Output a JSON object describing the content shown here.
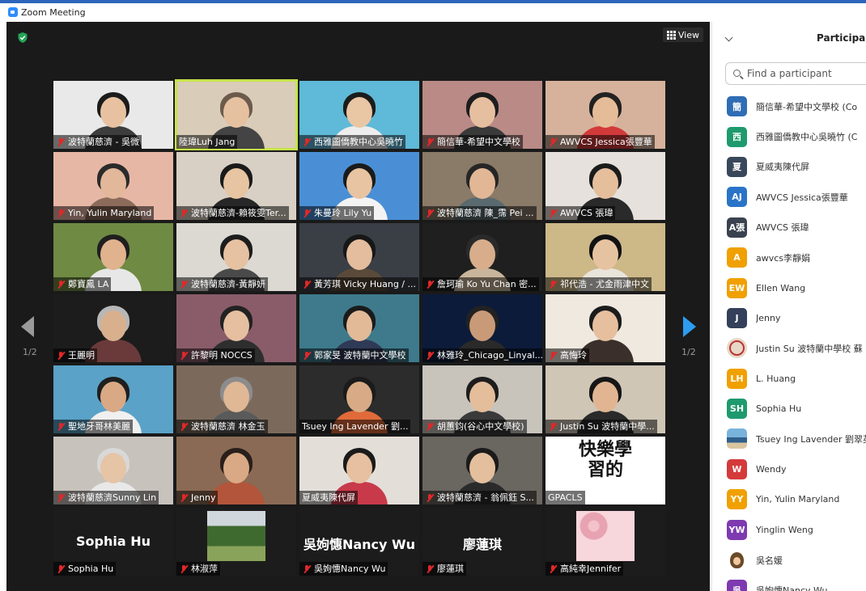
{
  "window": {
    "title": "Zoom Meeting"
  },
  "toolbar": {
    "view_label": "View"
  },
  "pagination": {
    "left": "1/2",
    "right": "1/2"
  },
  "tiles": [
    {
      "name": "波特蘭慈濟 - 吳微",
      "muted": true,
      "bg": "#e9e9e9",
      "skin": "#e8c2a0",
      "hair": "#1c1c1c",
      "shirt": "#3d3d3d"
    },
    {
      "name": "陸瑋Luh Jang",
      "muted": false,
      "active": true,
      "bg": "#d9ccb8",
      "skin": "#e6c1a0",
      "hair": "#6c5b4c",
      "shirt": "#444444"
    },
    {
      "name": "西雅圖僑教中心吳曉竹",
      "muted": true,
      "bg": "#5fb9d8",
      "skin": "#e9c6a4",
      "hair": "#1c1c1c",
      "shirt": "#ededed"
    },
    {
      "name": "簡信華-希望中文學校",
      "muted": true,
      "bg": "#b98a86",
      "skin": "#e6bfa0",
      "hair": "#1d1d1d",
      "shirt": "#3a3a3a"
    },
    {
      "name": "AWVCS Jessica張豐華",
      "muted": true,
      "bg": "#d6b29c",
      "skin": "#e5bc98",
      "hair": "#222222",
      "shirt": "#d23a3a"
    },
    {
      "name": "Yin, Yulin  Maryland",
      "muted": true,
      "bg": "#e7b7a6",
      "skin": "#e2b79a",
      "hair": "#2b2b2b",
      "shirt": "#8c6b5a"
    },
    {
      "name": "波特蘭慈濟-賴筱雯Ter...",
      "muted": true,
      "bg": "#d8d0c4",
      "skin": "#e7c4a2",
      "hair": "#1a1a1a",
      "shirt": "#272727"
    },
    {
      "name": "朱曼玲 Lily Yu",
      "muted": true,
      "bg": "#4a8fd6",
      "skin": "#e8c4a2",
      "hair": "#1b1b1b",
      "shirt": "#f3f3f3"
    },
    {
      "name": "波特蘭慈濟 陳_霈 Pei ...",
      "muted": true,
      "bg": "#8a7a68",
      "skin": "#e2b795",
      "hair": "#262626",
      "shirt": "#5a6a6f"
    },
    {
      "name": "AWVCS 張瑋",
      "muted": true,
      "bg": "#e6e1dc",
      "skin": "#e5be9c",
      "hair": "#1b1b1b",
      "shirt": "#2a2a2a"
    },
    {
      "name": "鄭寶鳳 LA",
      "muted": true,
      "bg": "#6f8a43",
      "skin": "#e0b28e",
      "hair": "#1f1f1f",
      "shirt": "#e7e7e7"
    },
    {
      "name": "波特蘭慈濟-黃靜妍",
      "muted": true,
      "bg": "#dcd8d2",
      "skin": "#e6c2a2",
      "hair": "#1d1d1d",
      "shirt": "#4a4a4a"
    },
    {
      "name": "黃芳琪 Vicky Huang / ...",
      "muted": true,
      "bg": "#3a3f46",
      "skin": "#e3bd9d",
      "hair": "#171717",
      "shirt": "#5a4a3a"
    },
    {
      "name": "詹珂瑜 Ko Yu Chan 密...",
      "muted": true,
      "bg": "#1f1f1f",
      "skin": "#d7ad8b",
      "hair": "#2a2a2a",
      "shirt": "#c9b59c"
    },
    {
      "name": "祁代浩 - 尤金雨津中文",
      "muted": true,
      "bg": "#cdb888",
      "skin": "#e6c3a0",
      "hair": "#121212",
      "shirt": "#e9e4dc"
    },
    {
      "name": "王麗明",
      "muted": true,
      "bg": "#1c1c1c",
      "skin": "#d9b08e",
      "hair": "#b7b7b7",
      "shirt": "#6a3a3a"
    },
    {
      "name": "許黎明 NOCCS",
      "muted": true,
      "bg": "#8a5c6a",
      "skin": "#e5bfa0",
      "hair": "#222222",
      "shirt": "#2e2e2e"
    },
    {
      "name": "郭家旻 波特蘭中文學校",
      "muted": true,
      "bg": "#3e7a8c",
      "skin": "#e2ba98",
      "hair": "#1b1b1b",
      "shirt": "#2f3a56"
    },
    {
      "name": "林雅玲_Chicago_Linyal...",
      "muted": true,
      "bg": "#0c1b3a",
      "skin": "#c99a78",
      "hair": "#222222",
      "shirt": "#2a2a2a"
    },
    {
      "name": "高悔玲",
      "muted": true,
      "bg": "#efe9e0",
      "skin": "#e6bf9e",
      "hair": "#1c1c1c",
      "shirt": "#3a2f2a"
    },
    {
      "name": "聖地牙哥林美麗",
      "muted": true,
      "bg": "#5aa2c8",
      "skin": "#d9a985",
      "hair": "#1f1f1f",
      "shirt": "#f0f0f0"
    },
    {
      "name": "波特蘭慈濟 林金玉",
      "muted": true,
      "bg": "#7b6a5c",
      "skin": "#e0b896",
      "hair": "#8c8c8c",
      "shirt": "#5a5a5a"
    },
    {
      "name": "Tsuey Ing Lavender 劉...",
      "muted": false,
      "bg": "#2c2c2c",
      "skin": "#d8ab86",
      "hair": "#1b1b1b",
      "shirt": "#e06a3a"
    },
    {
      "name": "胡蕙鈞(谷心中文學校)",
      "muted": true,
      "bg": "#c8c4bc",
      "skin": "#e4bd9b",
      "hair": "#1d1d1d",
      "shirt": "#3a3a3a"
    },
    {
      "name": "Justin Su 波特蘭中學...",
      "muted": true,
      "bg": "#cfc6b6",
      "skin": "#e1b592",
      "hair": "#161616",
      "shirt": "#2a2a2a"
    },
    {
      "name": "波特蘭慈濟Sunny Lin",
      "muted": true,
      "bg": "#c7c2bc",
      "skin": "#e6c4a6",
      "hair": "#d8d8d8",
      "shirt": "#e8e8e8"
    },
    {
      "name": "Jenny",
      "muted": true,
      "bg": "#8a6a54",
      "skin": "#d9a985",
      "hair": "#2a1f1a",
      "shirt": "#b2553a"
    },
    {
      "name": "夏威夷陳代屏",
      "muted": false,
      "bg": "#e3ded8",
      "skin": "#e6c0a0",
      "hair": "#1a1a1a",
      "shirt": "#c83a4a"
    },
    {
      "name": "波特蘭慈濟 - 翁佩鈺 S...",
      "muted": true,
      "bg": "#6a6660",
      "skin": "#e4bf9e",
      "hair": "#1b1b1b",
      "shirt": "#2a2a2a"
    },
    {
      "name": "GPACLS",
      "muted": false,
      "bg": "#ffffff",
      "calligraphy": "快樂學習的",
      "skin": "",
      "hair": "",
      "shirt": ""
    },
    {
      "name": "Sophia Hu",
      "muted": true,
      "bg": "#1c1c1c",
      "big": "Sophia Hu"
    },
    {
      "name": "林淑萍",
      "muted": true,
      "bg": "#1c1c1c",
      "photo": "garden"
    },
    {
      "name": "吳姁憓Nancy Wu",
      "muted": true,
      "bg": "#1c1c1c",
      "big": "吳姁憓Nancy  Wu"
    },
    {
      "name": "廖蓮琪",
      "muted": true,
      "bg": "#1c1c1c",
      "big": "廖蓮琪"
    },
    {
      "name": "高純幸Jennifer",
      "muted": true,
      "bg": "#1c1c1c",
      "photo": "blossom"
    }
  ],
  "participants": {
    "title": "Participant",
    "search_placeholder": "Find a participant",
    "list": [
      {
        "initials": "簡",
        "color": "#2f6db5",
        "name": "簡信華-希望中文學校 (Co"
      },
      {
        "initials": "西",
        "color": "#1f9a6e",
        "name": "西雅圖僑教中心吳曉竹 (C"
      },
      {
        "initials": "夏",
        "color": "#39475a",
        "name": "夏威夷陳代屏"
      },
      {
        "initials": "AJ",
        "color": "#2a74c7",
        "name": "AWVCS Jessica張豐華"
      },
      {
        "initials": "A張",
        "color": "#3a4250",
        "name": "AWVCS 張瑋"
      },
      {
        "initials": "A",
        "color": "#f0a000",
        "name": "awvcs李靜娟"
      },
      {
        "initials": "EW",
        "color": "#f0a000",
        "name": "Ellen Wang"
      },
      {
        "initials": "J",
        "color": "#34405a",
        "name": "Jenny"
      },
      {
        "initials": "",
        "color": "#e8d8c8",
        "name": "Justin Su 波特蘭中學校 蘇",
        "img": "seal"
      },
      {
        "initials": "LH",
        "color": "#f0a000",
        "name": "L. Huang"
      },
      {
        "initials": "SH",
        "color": "#1f9a6e",
        "name": "Sophia Hu"
      },
      {
        "initials": "",
        "color": "#6aa0c8",
        "name": "Tsuey Ing Lavender 劉翠英",
        "img": "beach"
      },
      {
        "initials": "W",
        "color": "#d43a3a",
        "name": "Wendy"
      },
      {
        "initials": "YY",
        "color": "#f0a000",
        "name": "Yin, Yulin  Maryland"
      },
      {
        "initials": "YW",
        "color": "#7e3ab0",
        "name": "Yinglin Weng"
      },
      {
        "initials": "",
        "color": "#ffffff",
        "name": "吳名媛",
        "img": "cartoon"
      },
      {
        "initials": "吳",
        "color": "#7e3ab0",
        "name": "吳姁憓Nancy Wu"
      }
    ]
  }
}
